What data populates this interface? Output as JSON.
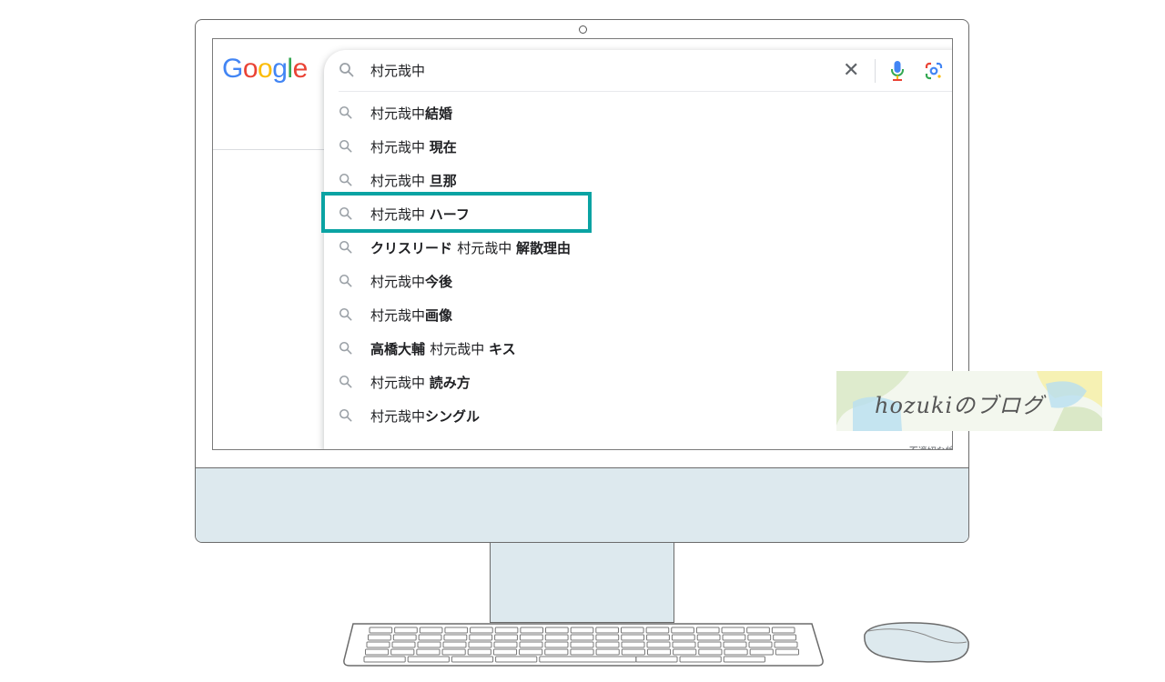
{
  "search": {
    "logo_letters": [
      "G",
      "o",
      "o",
      "g",
      "l",
      "e"
    ],
    "logo_colors": [
      "#4285f4",
      "#ea4335",
      "#fbbc05",
      "#4285f4",
      "#34a853",
      "#ea4335"
    ],
    "query": "村元哉中",
    "clear_icon": "close-icon",
    "mic_icon": "microphone-icon",
    "lens_icon": "google-lens-icon"
  },
  "suggestions": [
    {
      "plain_before": "",
      "bold_before": "",
      "plain": "村元哉中",
      "bold": "結婚",
      "highlighted": false
    },
    {
      "plain_before": "",
      "bold_before": "",
      "plain": "村元哉中 ",
      "bold": "現在",
      "highlighted": false
    },
    {
      "plain_before": "",
      "bold_before": "",
      "plain": "村元哉中 ",
      "bold": "旦那",
      "highlighted": false
    },
    {
      "plain_before": "",
      "bold_before": "",
      "plain": "村元哉中 ",
      "bold": "ハーフ",
      "highlighted": true
    },
    {
      "plain_before": "",
      "bold_before": "クリスリード ",
      "plain": "村元哉中 ",
      "bold": "解散理由",
      "highlighted": false
    },
    {
      "plain_before": "",
      "bold_before": "",
      "plain": "村元哉中",
      "bold": "今後",
      "highlighted": false
    },
    {
      "plain_before": "",
      "bold_before": "",
      "plain": "村元哉中",
      "bold": "画像",
      "highlighted": false
    },
    {
      "plain_before": "",
      "bold_before": "高橋大輔 ",
      "plain": "村元哉中 ",
      "bold": "キス",
      "highlighted": false
    },
    {
      "plain_before": "",
      "bold_before": "",
      "plain": "村元哉中 ",
      "bold": "読み方",
      "highlighted": false
    },
    {
      "plain_before": "",
      "bold_before": "",
      "plain": "村元哉中",
      "bold": "シングル",
      "highlighted": false
    }
  ],
  "report_link": "不適切な検索候補",
  "watermark": "hozukiのブログ",
  "colors": {
    "highlight_border": "#0aa3a3",
    "monitor_fill": "#dde9ee"
  }
}
